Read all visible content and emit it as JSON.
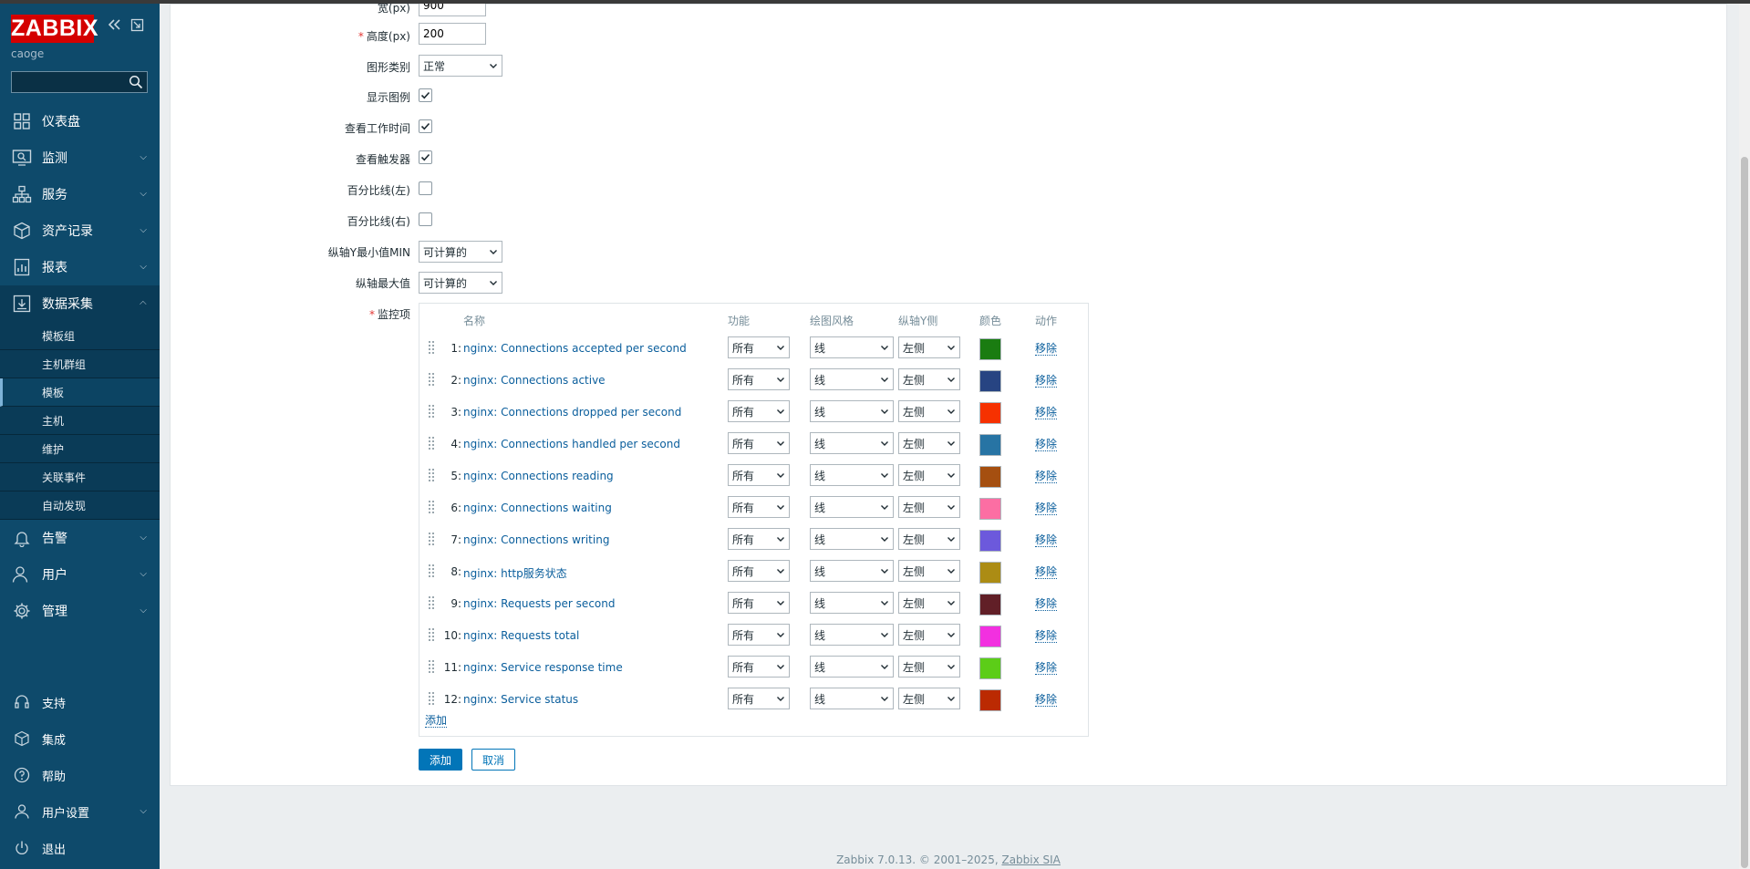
{
  "brand": {
    "logo": "ZABBIX",
    "user": "caoge"
  },
  "sidebar": {
    "menu": [
      {
        "label": "仪表盘",
        "icon": "dashboard-icon"
      },
      {
        "label": "监测",
        "icon": "monitoring-icon"
      },
      {
        "label": "服务",
        "icon": "services-icon"
      },
      {
        "label": "资产记录",
        "icon": "inventory-icon"
      },
      {
        "label": "报表",
        "icon": "reports-icon"
      },
      {
        "label": "数据采集",
        "icon": "data-collection-icon"
      }
    ],
    "submenu": [
      "模板组",
      "主机群组",
      "模板",
      "主机",
      "维护",
      "关联事件",
      "自动发现"
    ],
    "menu2": [
      {
        "label": "告警",
        "icon": "bell-icon"
      },
      {
        "label": "用户",
        "icon": "users-icon"
      },
      {
        "label": "管理",
        "icon": "gear-icon"
      }
    ],
    "bottom": [
      {
        "label": "支持",
        "icon": "headset-icon"
      },
      {
        "label": "集成",
        "icon": "integrations-icon"
      },
      {
        "label": "帮助",
        "icon": "help-icon"
      },
      {
        "label": "用户设置",
        "icon": "user-settings-icon"
      },
      {
        "label": "退出",
        "icon": "power-icon"
      }
    ]
  },
  "form": {
    "width_label": "宽(px)",
    "width_value": "900",
    "height_label": "高度(px)",
    "height_value": "200",
    "graph_type_label": "图形类别",
    "graph_type_value": "正常",
    "show_legend_label": "显示图例",
    "show_work_period_label": "查看工作时间",
    "show_triggers_label": "查看触发器",
    "percentile_left_label": "百分比线(左)",
    "percentile_right_label": "百分比线(右)",
    "ymin_label": "纵轴Y最小值MIN",
    "ymin_value": "可计算的",
    "ymax_label": "纵轴最大值",
    "ymax_value": "可计算的",
    "items_label": "监控项"
  },
  "items_table": {
    "headers": {
      "name": "名称",
      "function": "功能",
      "draw_style": "绘图风格",
      "y_axis": "纵轴Y侧",
      "color": "颜色",
      "action": "动作"
    },
    "rows": [
      {
        "num": "1:",
        "name": "nginx: Connections accepted per second",
        "function": "所有",
        "style": "线",
        "side": "左侧",
        "color": "#1A7C11"
      },
      {
        "num": "2:",
        "name": "nginx: Connections active",
        "function": "所有",
        "style": "线",
        "side": "左侧",
        "color": "#274482"
      },
      {
        "num": "3:",
        "name": "nginx: Connections dropped per second",
        "function": "所有",
        "style": "线",
        "side": "左侧",
        "color": "#F63100"
      },
      {
        "num": "4:",
        "name": "nginx: Connections handled per second",
        "function": "所有",
        "style": "线",
        "side": "左侧",
        "color": "#2774A4"
      },
      {
        "num": "5:",
        "name": "nginx: Connections reading",
        "function": "所有",
        "style": "线",
        "side": "左侧",
        "color": "#A54F10"
      },
      {
        "num": "6:",
        "name": "nginx: Connections waiting",
        "function": "所有",
        "style": "线",
        "side": "左侧",
        "color": "#FC6EA3"
      },
      {
        "num": "7:",
        "name": "nginx: Connections writing",
        "function": "所有",
        "style": "线",
        "side": "左侧",
        "color": "#6C59DC"
      },
      {
        "num": "8:",
        "name": "nginx: http服务状态",
        "function": "所有",
        "style": "线",
        "side": "左侧",
        "color": "#AC8C14"
      },
      {
        "num": "9:",
        "name": "nginx: Requests per second",
        "function": "所有",
        "style": "线",
        "side": "左侧",
        "color": "#611F27"
      },
      {
        "num": "10:",
        "name": "nginx: Requests total",
        "function": "所有",
        "style": "线",
        "side": "左侧",
        "color": "#F230E0"
      },
      {
        "num": "11:",
        "name": "nginx: Service response time",
        "function": "所有",
        "style": "线",
        "side": "左侧",
        "color": "#5CCD18"
      },
      {
        "num": "12:",
        "name": "nginx: Service status",
        "function": "所有",
        "style": "线",
        "side": "左侧",
        "color": "#BB2A02"
      }
    ],
    "remove_label": "移除",
    "add_label": "添加"
  },
  "buttons": {
    "add": "添加",
    "cancel": "取消"
  },
  "footer": {
    "version": "Zabbix 7.0.13. © 2001–2025,",
    "company": "Zabbix SIA"
  }
}
